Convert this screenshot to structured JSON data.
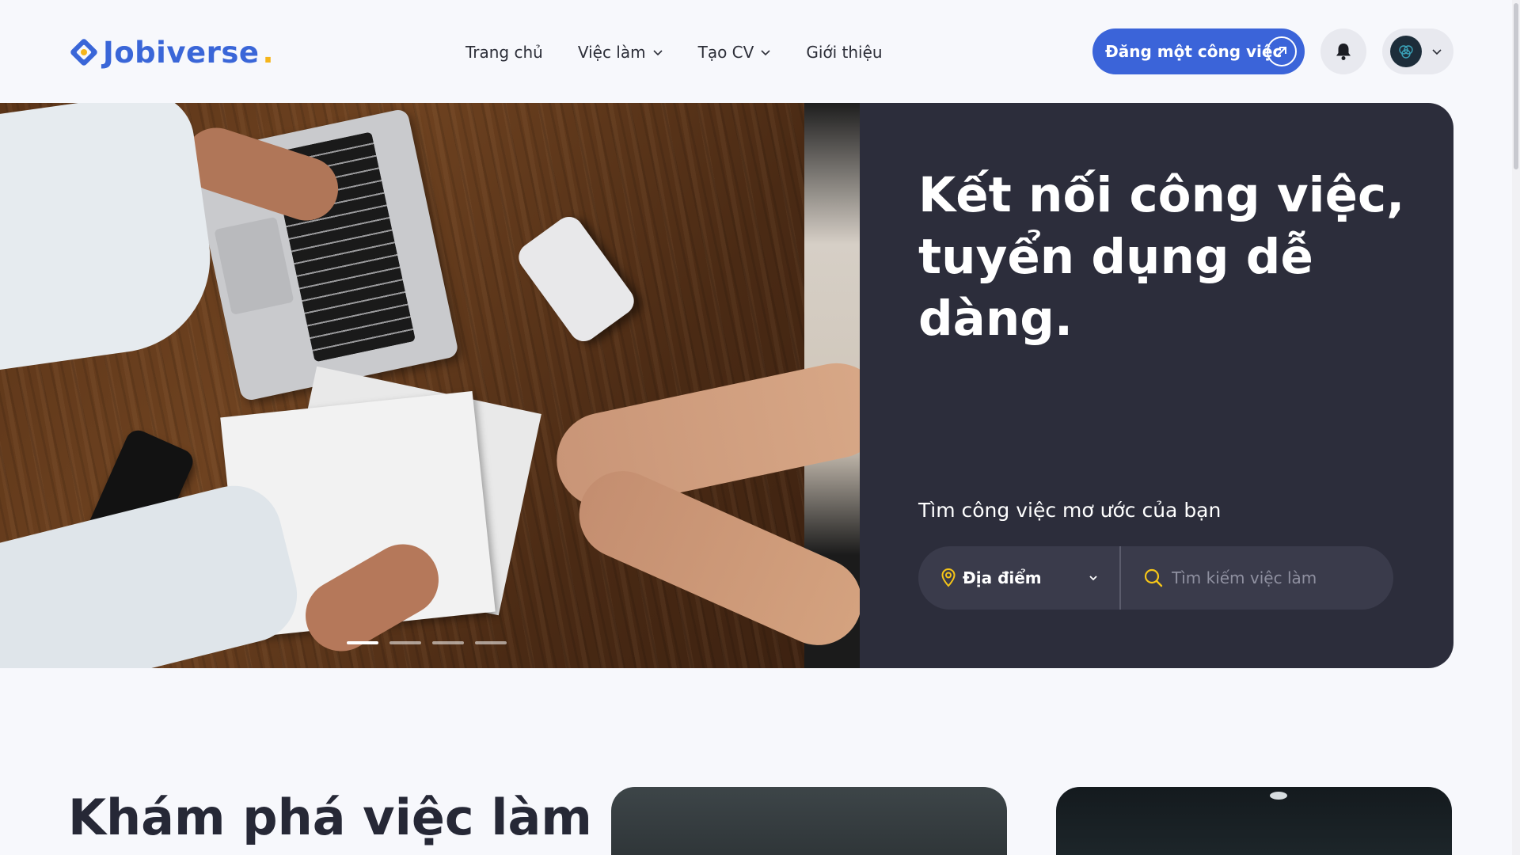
{
  "brand": {
    "name": "Jobiverse",
    "dot": ".",
    "primary": "#3b64d9",
    "accent": "#f5b51b"
  },
  "nav": {
    "items": [
      {
        "label": "Trang chủ",
        "dropdown": false
      },
      {
        "label": "Việc làm",
        "dropdown": true
      },
      {
        "label": "Tạo CV",
        "dropdown": true
      },
      {
        "label": "Giới thiệu",
        "dropdown": false
      }
    ]
  },
  "header_actions": {
    "post_job_label": "Đăng một công việc",
    "post_job_icon": "arrow-up-right-icon",
    "notification_icon": "bell-icon",
    "profile_icon": "avatar",
    "profile_chevron": "chevron-down-icon"
  },
  "hero": {
    "title": "Kết nối công việc, tuyển dụng dễ dàng.",
    "subtitle": "Tìm công việc mơ ước của bạn",
    "location_label": "Địa điểm",
    "search_placeholder": "Tìm kiếm việc làm",
    "carousel": {
      "slides": 4,
      "active": 1
    },
    "panel_color": "#2c2d3b"
  },
  "explore": {
    "title": "Khám phá việc làm"
  }
}
